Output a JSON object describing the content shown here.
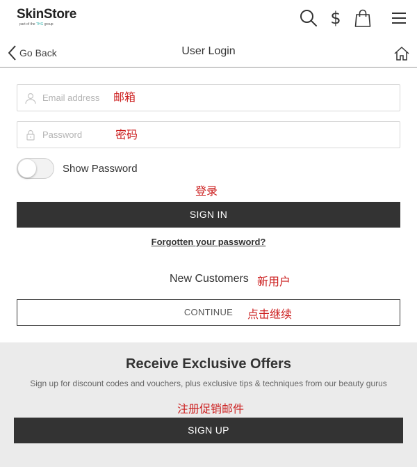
{
  "header": {
    "logo_main": "SkinStore",
    "logo_sub_prefix": "part of the ",
    "logo_sub_group": "THG",
    "logo_sub_suffix": " group",
    "icons": [
      "search-icon",
      "dollar-icon",
      "shopping-bag-icon",
      "menu-icon"
    ],
    "currency_symbol": "$"
  },
  "nav": {
    "back_label": "Go Back",
    "title": "User Login"
  },
  "form": {
    "email_placeholder": "Email address",
    "email_annotation": "邮箱",
    "password_placeholder": "Password",
    "password_annotation": "密码",
    "show_password_label": "Show Password",
    "show_password_on": false,
    "signin_annotation": "登录",
    "signin_label": "SIGN IN",
    "forgot_label": "Forgotten your password?"
  },
  "new_customers": {
    "heading": "New Customers",
    "heading_annotation": "新用户",
    "continue_label": "CONTINUE",
    "continue_annotation": "点击继续"
  },
  "offers": {
    "title": "Receive Exclusive Offers",
    "description": "Sign up for discount codes and vouchers, plus exclusive tips & techniques from our beauty gurus",
    "signup_annotation": "注册促销邮件",
    "signup_label": "SIGN UP"
  },
  "colors": {
    "annotation": "#cc1f1f",
    "dark_button": "#333333",
    "offers_bg": "#ebebeb",
    "logo_accent": "#3cb8b2"
  }
}
